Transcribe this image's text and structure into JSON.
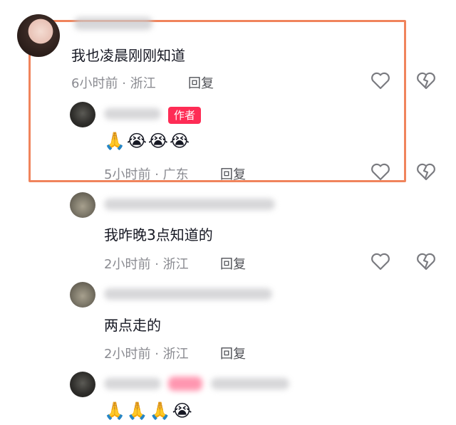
{
  "colors": {
    "highlight_border": "#f0845c",
    "author_badge": "#fe2c55",
    "meta": "#8a8b91"
  },
  "comments": [
    {
      "text": "我也凌晨刚刚知道",
      "time": "6小时前",
      "location": "浙江",
      "reply": "回复",
      "separator": "·"
    },
    {
      "author_badge": "作者",
      "emojis": "🙏😭😭😭",
      "time": "5小时前",
      "location": "广东",
      "reply": "回复",
      "separator": "·"
    },
    {
      "text": "我昨晚3点知道的",
      "time": "2小时前",
      "location": "浙江",
      "reply": "回复",
      "separator": "·"
    },
    {
      "text": "两点走的",
      "time": "2小时前",
      "location": "浙江",
      "reply": "回复",
      "separator": "·"
    },
    {
      "emojis": "🙏🙏🙏😭"
    }
  ],
  "icons": {
    "like": "heart-outline-icon",
    "dislike": "broken-heart-icon"
  }
}
